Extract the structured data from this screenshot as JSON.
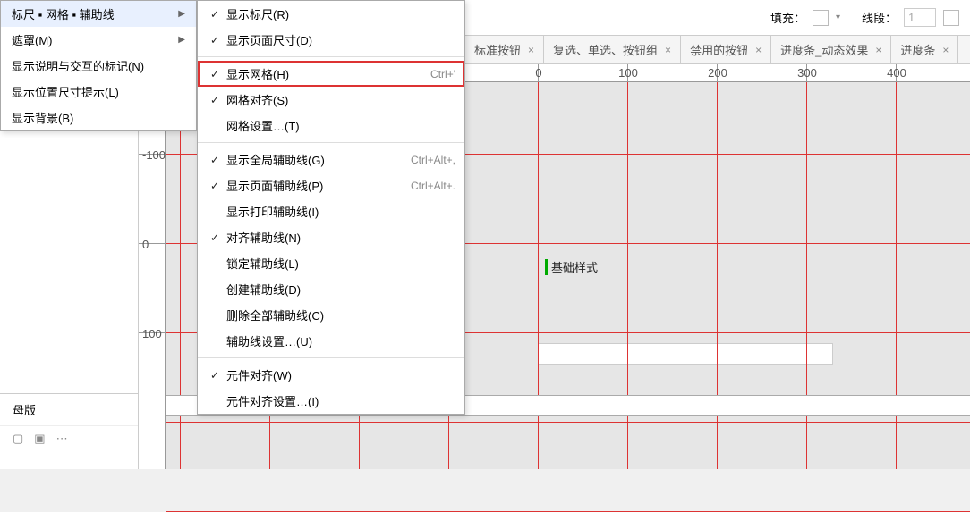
{
  "toolbar": {
    "fill_label": "填充：",
    "line_label": "线段：",
    "line_value": "1"
  },
  "tabs": [
    {
      "label": "标准按钮",
      "active": false
    },
    {
      "label": "复选、单选、按钮组",
      "active": false
    },
    {
      "label": "禁用的按钮",
      "active": false
    },
    {
      "label": "进度条_动态效果",
      "active": false
    },
    {
      "label": "进度条",
      "active": false
    }
  ],
  "ruler_h": [
    0,
    100,
    200,
    300,
    400
  ],
  "ruler_v": [
    -100,
    0,
    100
  ],
  "canvas": {
    "sample_text": "基础样式"
  },
  "left_panel": {
    "tab_label": "母版"
  },
  "menu1": [
    {
      "label": "标尺 ▪ 网格 ▪ 辅助线",
      "arrow": true,
      "selected": true
    },
    {
      "label": "遮罩(M)",
      "arrow": true
    },
    {
      "label": "显示说明与交互的标记(N)"
    },
    {
      "label": "显示位置尺寸提示(L)"
    },
    {
      "label": "显示背景(B)"
    }
  ],
  "menu2": [
    {
      "check": true,
      "label": "显示标尺(R)",
      "shortcut": ""
    },
    {
      "check": true,
      "label": "显示页面尺寸(D)",
      "shortcut": ""
    },
    {
      "sep": true
    },
    {
      "check": true,
      "label": "显示网格(H)",
      "shortcut": "Ctrl+'",
      "highlight": true
    },
    {
      "check": true,
      "label": "网格对齐(S)",
      "shortcut": ""
    },
    {
      "check": false,
      "label": "网格设置…(T)",
      "shortcut": ""
    },
    {
      "sep": true
    },
    {
      "check": true,
      "label": "显示全局辅助线(G)",
      "shortcut": "Ctrl+Alt+,"
    },
    {
      "check": true,
      "label": "显示页面辅助线(P)",
      "shortcut": "Ctrl+Alt+."
    },
    {
      "check": false,
      "label": "显示打印辅助线(I)",
      "shortcut": ""
    },
    {
      "check": true,
      "label": "对齐辅助线(N)",
      "shortcut": ""
    },
    {
      "check": false,
      "label": "锁定辅助线(L)",
      "shortcut": ""
    },
    {
      "check": false,
      "label": "创建辅助线(D)",
      "shortcut": ""
    },
    {
      "check": false,
      "label": "删除全部辅助线(C)",
      "shortcut": ""
    },
    {
      "check": false,
      "label": "辅助线设置…(U)",
      "shortcut": ""
    },
    {
      "sep": true
    },
    {
      "check": true,
      "label": "元件对齐(W)",
      "shortcut": ""
    },
    {
      "check": false,
      "label": "元件对齐设置…(I)",
      "shortcut": ""
    }
  ]
}
